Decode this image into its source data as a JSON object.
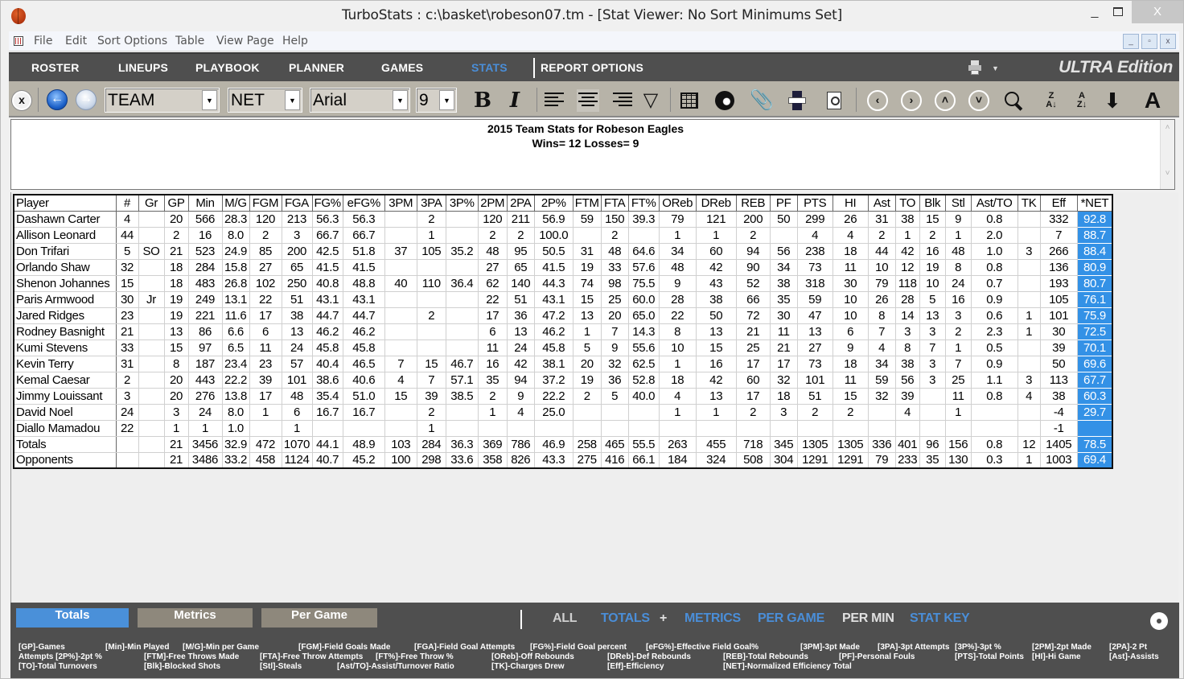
{
  "window": {
    "title": "TurboStats : c:\\basket\\robeson07.tm - [Stat Viewer: No Sort Minimums Set]",
    "minimize": "_",
    "close": "X"
  },
  "menu": {
    "items": [
      "File",
      "Edit",
      "Sort Options",
      "Table",
      "View Page",
      "Help"
    ],
    "mdi": [
      "_",
      "▫",
      "x"
    ]
  },
  "nav": {
    "items": [
      "ROSTER",
      "LINEUPS",
      "PLAYBOOK",
      "PLANNER",
      "GAMES",
      "STATS"
    ],
    "active": "STATS",
    "report_options": "REPORT OPTIONS",
    "edition": "ULTRA Edition"
  },
  "toolbar": {
    "close": "x",
    "back": "←",
    "forward": "→",
    "team_select": "TEAM",
    "stat_select": "NET",
    "font_select": "Arial",
    "size_select": "9",
    "bold": "B",
    "italic": "I",
    "prev": "‹",
    "next": "›",
    "up": "˄",
    "down": "˅",
    "sort_za": "Z\nA↓",
    "sort_az": "A\nZ↓",
    "download": "⬇",
    "font_size": "A",
    "paperclip": "📎",
    "dropdown_arrow": "▼"
  },
  "header": {
    "line1": "2015 Team Stats for Robeson Eagles",
    "line2": "Wins=  12 Losses=  9",
    "scroll_up": "˄",
    "scroll_down": "˅"
  },
  "table": {
    "columns": [
      "Player",
      "#",
      "Gr",
      "GP",
      "Min",
      "M/G",
      "FGM",
      "FGA",
      "FG%",
      "eFG%",
      "3PM",
      "3PA",
      "3P%",
      "2PM",
      "2PA",
      "2P%",
      "FTM",
      "FTA",
      "FT%",
      "OReb",
      "DReb",
      "REB",
      "PF",
      "PTS",
      "HI",
      "Ast",
      "TO",
      "Blk",
      "Stl",
      "Ast/TO",
      "TK",
      "Eff",
      "*NET"
    ],
    "rows": [
      [
        "Dashawn Carter",
        "4",
        "",
        "20",
        "566",
        "28.3",
        "120",
        "213",
        "56.3",
        "56.3",
        "",
        "2",
        "",
        "120",
        "211",
        "56.9",
        "59",
        "150",
        "39.3",
        "79",
        "121",
        "200",
        "50",
        "299",
        "26",
        "31",
        "38",
        "15",
        "9",
        "0.8",
        "",
        "332",
        "92.8"
      ],
      [
        "Allison Leonard",
        "44",
        "",
        "2",
        "16",
        "8.0",
        "2",
        "3",
        "66.7",
        "66.7",
        "",
        "1",
        "",
        "2",
        "2",
        "100.0",
        "",
        "2",
        "",
        "1",
        "1",
        "2",
        "",
        "4",
        "4",
        "2",
        "1",
        "2",
        "1",
        "2.0",
        "",
        "7",
        "88.7"
      ],
      [
        "Don Trifari",
        "5",
        "SO",
        "21",
        "523",
        "24.9",
        "85",
        "200",
        "42.5",
        "51.8",
        "37",
        "105",
        "35.2",
        "48",
        "95",
        "50.5",
        "31",
        "48",
        "64.6",
        "34",
        "60",
        "94",
        "56",
        "238",
        "18",
        "44",
        "42",
        "16",
        "48",
        "1.0",
        "3",
        "266",
        "88.4"
      ],
      [
        "Orlando Shaw",
        "32",
        "",
        "18",
        "284",
        "15.8",
        "27",
        "65",
        "41.5",
        "41.5",
        "",
        "",
        "",
        "27",
        "65",
        "41.5",
        "19",
        "33",
        "57.6",
        "48",
        "42",
        "90",
        "34",
        "73",
        "11",
        "10",
        "12",
        "19",
        "8",
        "0.8",
        "",
        "136",
        "80.9"
      ],
      [
        "Shenon Johannes",
        "15",
        "",
        "18",
        "483",
        "26.8",
        "102",
        "250",
        "40.8",
        "48.8",
        "40",
        "110",
        "36.4",
        "62",
        "140",
        "44.3",
        "74",
        "98",
        "75.5",
        "9",
        "43",
        "52",
        "38",
        "318",
        "30",
        "79",
        "118",
        "10",
        "24",
        "0.7",
        "",
        "193",
        "80.7"
      ],
      [
        "Paris Armwood",
        "30",
        "Jr",
        "19",
        "249",
        "13.1",
        "22",
        "51",
        "43.1",
        "43.1",
        "",
        "",
        "",
        "22",
        "51",
        "43.1",
        "15",
        "25",
        "60.0",
        "28",
        "38",
        "66",
        "35",
        "59",
        "10",
        "26",
        "28",
        "5",
        "16",
        "0.9",
        "",
        "105",
        "76.1"
      ],
      [
        "Jared Ridges",
        "23",
        "",
        "19",
        "221",
        "11.6",
        "17",
        "38",
        "44.7",
        "44.7",
        "",
        "2",
        "",
        "17",
        "36",
        "47.2",
        "13",
        "20",
        "65.0",
        "22",
        "50",
        "72",
        "30",
        "47",
        "10",
        "8",
        "14",
        "13",
        "3",
        "0.6",
        "1",
        "101",
        "75.9"
      ],
      [
        "Rodney Basnight",
        "21",
        "",
        "13",
        "86",
        "6.6",
        "6",
        "13",
        "46.2",
        "46.2",
        "",
        "",
        "",
        "6",
        "13",
        "46.2",
        "1",
        "7",
        "14.3",
        "8",
        "13",
        "21",
        "11",
        "13",
        "6",
        "7",
        "3",
        "3",
        "2",
        "2.3",
        "1",
        "30",
        "72.5"
      ],
      [
        "Kumi Stevens",
        "33",
        "",
        "15",
        "97",
        "6.5",
        "11",
        "24",
        "45.8",
        "45.8",
        "",
        "",
        "",
        "11",
        "24",
        "45.8",
        "5",
        "9",
        "55.6",
        "10",
        "15",
        "25",
        "21",
        "27",
        "9",
        "4",
        "8",
        "7",
        "1",
        "0.5",
        "",
        "39",
        "70.1"
      ],
      [
        "Kevin Terry",
        "31",
        "",
        "8",
        "187",
        "23.4",
        "23",
        "57",
        "40.4",
        "46.5",
        "7",
        "15",
        "46.7",
        "16",
        "42",
        "38.1",
        "20",
        "32",
        "62.5",
        "1",
        "16",
        "17",
        "17",
        "73",
        "18",
        "34",
        "38",
        "3",
        "7",
        "0.9",
        "",
        "50",
        "69.6"
      ],
      [
        "Kemal Caesar",
        "2",
        "",
        "20",
        "443",
        "22.2",
        "39",
        "101",
        "38.6",
        "40.6",
        "4",
        "7",
        "57.1",
        "35",
        "94",
        "37.2",
        "19",
        "36",
        "52.8",
        "18",
        "42",
        "60",
        "32",
        "101",
        "11",
        "59",
        "56",
        "3",
        "25",
        "1.1",
        "3",
        "113",
        "67.7"
      ],
      [
        "Jimmy Louissant",
        "3",
        "",
        "20",
        "276",
        "13.8",
        "17",
        "48",
        "35.4",
        "51.0",
        "15",
        "39",
        "38.5",
        "2",
        "9",
        "22.2",
        "2",
        "5",
        "40.0",
        "4",
        "13",
        "17",
        "18",
        "51",
        "15",
        "32",
        "39",
        "",
        "11",
        "0.8",
        "4",
        "38",
        "60.3"
      ],
      [
        "David Noel",
        "24",
        "",
        "3",
        "24",
        "8.0",
        "1",
        "6",
        "16.7",
        "16.7",
        "",
        "2",
        "",
        "1",
        "4",
        "25.0",
        "",
        "",
        "",
        "1",
        "1",
        "2",
        "3",
        "2",
        "2",
        "",
        "4",
        "",
        "1",
        "",
        "",
        "-4",
        "29.7"
      ],
      [
        "Diallo Mamadou",
        "22",
        "",
        "1",
        "1",
        "1.0",
        "",
        "1",
        "",
        "",
        "",
        "1",
        "",
        "",
        "",
        "",
        "",
        "",
        "",
        "",
        "",
        "",
        "",
        "",
        "",
        "",
        "",
        "",
        "",
        "",
        "",
        "-1",
        ""
      ],
      [
        "Totals",
        "",
        "",
        "21",
        "3456",
        "32.9",
        "472",
        "1070",
        "44.1",
        "48.9",
        "103",
        "284",
        "36.3",
        "369",
        "786",
        "46.9",
        "258",
        "465",
        "55.5",
        "263",
        "455",
        "718",
        "345",
        "1305",
        "1305",
        "336",
        "401",
        "96",
        "156",
        "0.8",
        "12",
        "1405",
        "78.5"
      ],
      [
        "Opponents",
        "",
        "",
        "21",
        "3486",
        "33.2",
        "458",
        "1124",
        "40.7",
        "45.2",
        "100",
        "298",
        "33.6",
        "358",
        "826",
        "43.3",
        "275",
        "416",
        "66.1",
        "184",
        "324",
        "508",
        "304",
        "1291",
        "1291",
        "79",
        "233",
        "35",
        "130",
        "0.3",
        "1",
        "1003",
        "69.4"
      ]
    ]
  },
  "bottom": {
    "tabs": [
      "Totals",
      "Metrics",
      "Per Game"
    ],
    "active_tab": "Totals",
    "links": [
      {
        "label": "ALL",
        "color": "#cfcfcf"
      },
      {
        "label": "TOTALS",
        "color": "#4a8ed8"
      },
      {
        "label": "+",
        "color": "#e0e0e0"
      },
      {
        "label": "METRICS",
        "color": "#4a8ed8"
      },
      {
        "label": "PER GAME",
        "color": "#4a8ed8"
      },
      {
        "label": "PER MIN",
        "color": "#e0e0e0"
      },
      {
        "label": "STAT KEY",
        "color": "#4a8ed8"
      }
    ],
    "key": [
      [
        "[GP]-Games",
        "[Min]-Min Played",
        "[M/G]-Min per Game",
        "[FGM]-Field Goals Made",
        "[FGA]-Field Goal Attempts",
        "[FG%]-Field Goal percent",
        "[eFG%]-Effective Field Goal%",
        "[3PM]-3pt Made",
        "[3PA]-3pt Attempts",
        "[3P%]-3pt %",
        "[2PM]-2pt Made",
        "[2PA]-2 Pt"
      ],
      [
        "Attempts  [2P%]-2pt %",
        "[FTM]-Free Throws Made",
        "[FTA]-Free Throw Attempts",
        "[FT%]-Free Throw %",
        "[OReb]-Off Rebounds",
        "[DReb]-Def Rebounds",
        "[REB]-Total Rebounds",
        "[PF]-Personal Fouls",
        "[PTS]-Total Points",
        "[HI]-Hi Game",
        "[Ast]-Assists"
      ],
      [
        "[TO]-Total Turnovers",
        "[Blk]-Blocked Shots",
        "[Stl]-Steals",
        "[Ast/TO]-Assist/Turnover Ratio",
        "[TK]-Charges Drew",
        "[Eff]-Efficiency",
        "[NET]-Normalized Efficiency Total"
      ]
    ]
  },
  "colors": {
    "accent": "#4a8ed8",
    "net_highlight": "#3391e6",
    "nav_bg": "#4f4f4f",
    "toolbar_bg": "#b7b3a8"
  }
}
